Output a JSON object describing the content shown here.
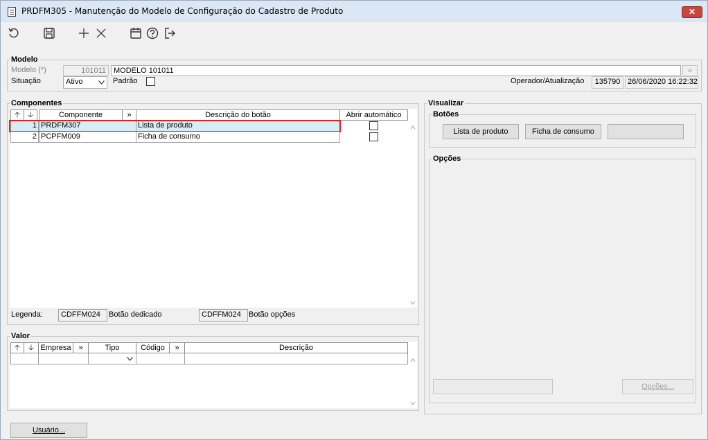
{
  "window": {
    "title": "PRDFM305 - Manutenção do Modelo de Configuração do Cadastro de Produto",
    "close_label": "✕"
  },
  "toolbar": {
    "icons": [
      "refresh-icon",
      "save-icon",
      "add-icon",
      "delete-icon",
      "calendar-icon",
      "help-icon",
      "exit-icon"
    ]
  },
  "modelo": {
    "section_title": "Modelo",
    "modelo_label": "Modelo (*)",
    "modelo_code": "101011",
    "modelo_name": "MODELO 101011",
    "lookup_label": "»",
    "situacao_label": "Situação",
    "situacao_value": "Ativo",
    "padrao_label": "Padrão",
    "operador_label": "Operador/Atualização",
    "operador_value": "135790",
    "atualizacao_value": "26/06/2020 16:22:32"
  },
  "componentes": {
    "section_title": "Componentes",
    "headers": {
      "up": "🡡",
      "down": "🡣",
      "componente": "Componente",
      "more": "»",
      "descricao": "Descrição do botão",
      "abrir": "Abrir automático"
    },
    "rows": [
      {
        "seq": "1",
        "componente": "PRDFM307",
        "descricao": "Lista de produto",
        "selected": true
      },
      {
        "seq": "2",
        "componente": "PCPFM009",
        "descricao": "Ficha de consumo",
        "selected": false
      }
    ],
    "legenda_label": "Legenda:",
    "legenda1_value": "CDFFM024",
    "legenda1_text": "Botão dedicado",
    "legenda2_value": "CDFFM024",
    "legenda2_text": "Botão opções"
  },
  "valor": {
    "section_title": "Valor",
    "headers": {
      "up": "🡡",
      "down": "🡣",
      "empresa": "Empresa",
      "more1": "»",
      "tipo": "Tipo",
      "codigo": "Código",
      "more2": "»",
      "descricao": "Descrição"
    }
  },
  "visualizar": {
    "section_title": "Visualizar",
    "botoes_title": "Botões",
    "buttons": [
      "Lista de produto",
      "Ficha de consumo",
      ""
    ],
    "opcoes_title": "Opções",
    "opcoes_button": "Opções..."
  },
  "footer": {
    "usuario_button": "Usuário..."
  }
}
